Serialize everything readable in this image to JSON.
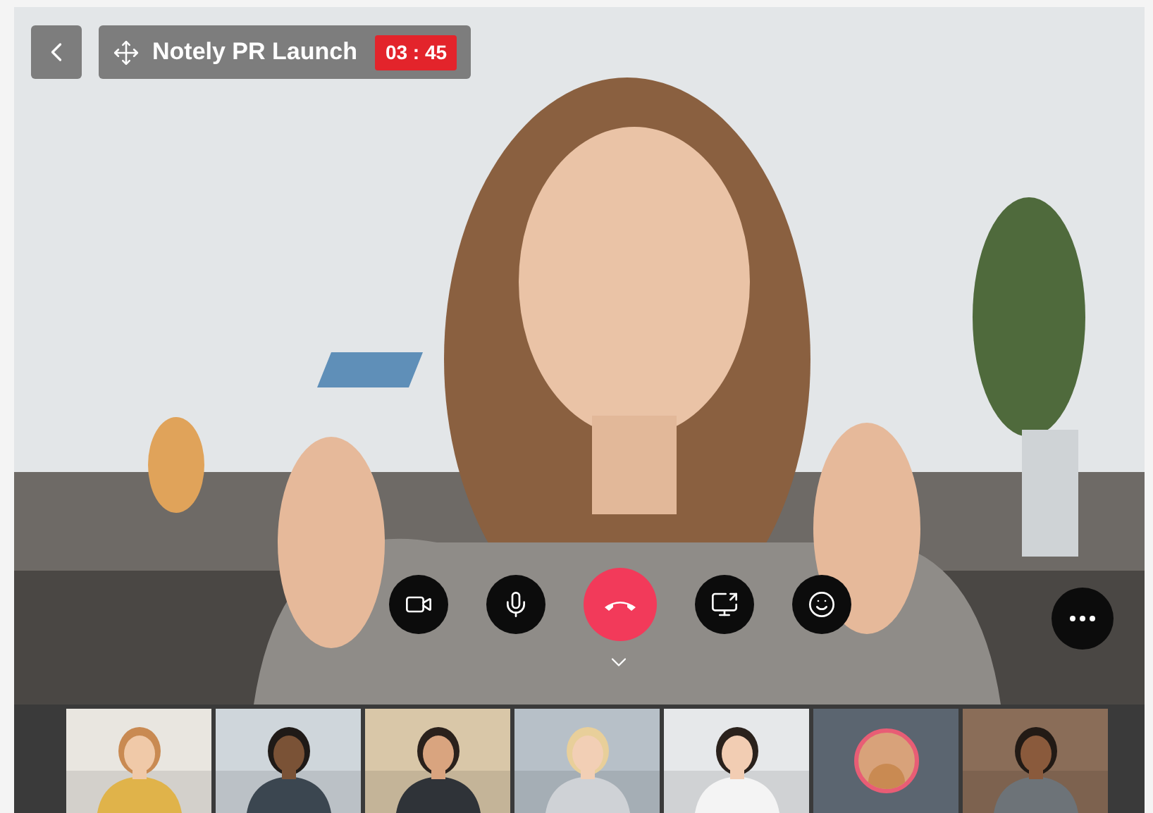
{
  "meeting": {
    "title": "Notely PR Launch",
    "timer": "03 : 45"
  },
  "controls": [
    {
      "kind": "camera"
    },
    {
      "kind": "microphone"
    },
    {
      "kind": "end-call"
    },
    {
      "kind": "share-screen"
    },
    {
      "kind": "reactions"
    }
  ],
  "participants": [
    {
      "kind": "video"
    },
    {
      "kind": "video"
    },
    {
      "kind": "video"
    },
    {
      "kind": "video"
    },
    {
      "kind": "video"
    },
    {
      "kind": "avatar"
    },
    {
      "kind": "video"
    }
  ]
}
